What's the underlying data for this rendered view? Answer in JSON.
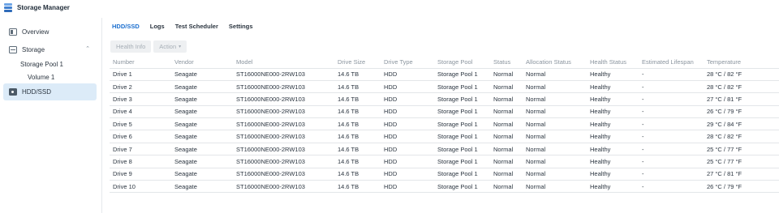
{
  "app": {
    "title": "Storage Manager"
  },
  "sidebar": {
    "overview": "Overview",
    "storage": "Storage",
    "storage_pool": "Storage Pool 1",
    "volume": "Volume 1",
    "hdd_ssd": "HDD/SSD"
  },
  "tabs": [
    "HDD/SSD",
    "Logs",
    "Test Scheduler",
    "Settings"
  ],
  "toolbar": {
    "health_info": "Health Info",
    "action": "Action"
  },
  "table": {
    "headers": [
      "Number",
      "Vendor",
      "Model",
      "Drive Size",
      "Drive Type",
      "Storage Pool",
      "Status",
      "Allocation Status",
      "Health Status",
      "Estimated Lifespan",
      "Temperature"
    ],
    "rows": [
      [
        "Drive 1",
        "Seagate",
        "ST16000NE000-2RW103",
        "14.6 TB",
        "HDD",
        "Storage Pool 1",
        "Normal",
        "Normal",
        "Healthy",
        "-",
        "28 °C / 82 °F"
      ],
      [
        "Drive 2",
        "Seagate",
        "ST16000NE000-2RW103",
        "14.6 TB",
        "HDD",
        "Storage Pool 1",
        "Normal",
        "Normal",
        "Healthy",
        "-",
        "28 °C / 82 °F"
      ],
      [
        "Drive 3",
        "Seagate",
        "ST16000NE000-2RW103",
        "14.6 TB",
        "HDD",
        "Storage Pool 1",
        "Normal",
        "Normal",
        "Healthy",
        "-",
        "27 °C / 81 °F"
      ],
      [
        "Drive 4",
        "Seagate",
        "ST16000NE000-2RW103",
        "14.6 TB",
        "HDD",
        "Storage Pool 1",
        "Normal",
        "Normal",
        "Healthy",
        "-",
        "26 °C / 79 °F"
      ],
      [
        "Drive 5",
        "Seagate",
        "ST16000NE000-2RW103",
        "14.6 TB",
        "HDD",
        "Storage Pool 1",
        "Normal",
        "Normal",
        "Healthy",
        "-",
        "29 °C / 84 °F"
      ],
      [
        "Drive 6",
        "Seagate",
        "ST16000NE000-2RW103",
        "14.6 TB",
        "HDD",
        "Storage Pool 1",
        "Normal",
        "Normal",
        "Healthy",
        "-",
        "28 °C / 82 °F"
      ],
      [
        "Drive 7",
        "Seagate",
        "ST16000NE000-2RW103",
        "14.6 TB",
        "HDD",
        "Storage Pool 1",
        "Normal",
        "Normal",
        "Healthy",
        "-",
        "25 °C / 77 °F"
      ],
      [
        "Drive 8",
        "Seagate",
        "ST16000NE000-2RW103",
        "14.6 TB",
        "HDD",
        "Storage Pool 1",
        "Normal",
        "Normal",
        "Healthy",
        "-",
        "25 °C / 77 °F"
      ],
      [
        "Drive 9",
        "Seagate",
        "ST16000NE000-2RW103",
        "14.6 TB",
        "HDD",
        "Storage Pool 1",
        "Normal",
        "Normal",
        "Healthy",
        "-",
        "27 °C / 81 °F"
      ],
      [
        "Drive 10",
        "Seagate",
        "ST16000NE000-2RW103",
        "14.6 TB",
        "HDD",
        "Storage Pool 1",
        "Normal",
        "Normal",
        "Healthy",
        "-",
        "26 °C / 79 °F"
      ]
    ]
  },
  "colors": {
    "accent": "#1c6fcf",
    "ok": "#2a9a2a",
    "active_bg": "#dcebf8"
  }
}
